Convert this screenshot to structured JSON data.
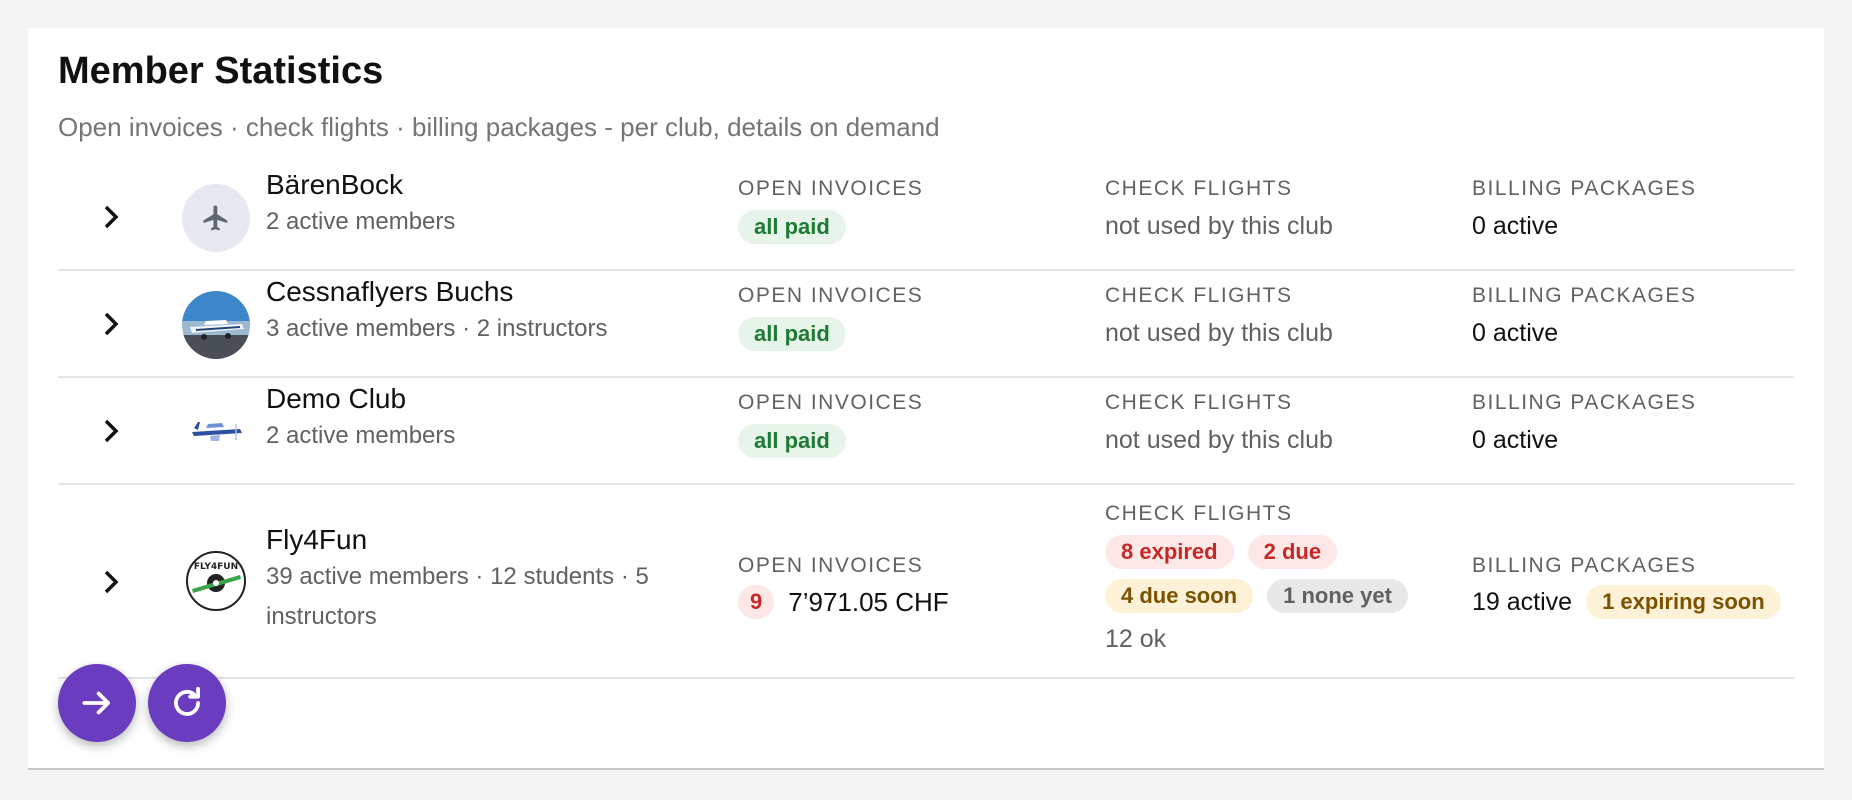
{
  "header": {
    "title": "Member Statistics",
    "subtitle": "Open invoices · check flights · billing packages - per club, details on demand"
  },
  "labels": {
    "open_invoices": "OPEN INVOICES",
    "check_flights": "CHECK FLIGHTS",
    "billing_packages": "BILLING PACKAGES"
  },
  "clubs": [
    {
      "name": "BärenBock",
      "meta": "2 active members",
      "avatar_icon": "airplane-icon",
      "open_invoices": {
        "status": "all paid"
      },
      "check_flights": {
        "text": "not used by this club"
      },
      "billing_packages": {
        "active": "0 active"
      }
    },
    {
      "name": "Cessnaflyers Buchs",
      "meta": "3 active members · 2 instructors",
      "avatar_icon": "aircraft-photo",
      "open_invoices": {
        "status": "all paid"
      },
      "check_flights": {
        "text": "not used by this club"
      },
      "billing_packages": {
        "active": "0 active"
      }
    },
    {
      "name": "Demo Club",
      "meta": "2 active members",
      "avatar_icon": "aircraft-logo",
      "open_invoices": {
        "status": "all paid"
      },
      "check_flights": {
        "text": "not used by this club"
      },
      "billing_packages": {
        "active": "0 active"
      }
    },
    {
      "name": "Fly4Fun",
      "meta": "39 active members · 12 students · 5 instructors",
      "avatar_icon": "fly4fun-logo",
      "avatar_text": "FLY4FUN",
      "open_invoices": {
        "count": "9",
        "amount": "7’971.05 CHF"
      },
      "check_flights": {
        "expired": "8 expired",
        "due": "2 due",
        "due_soon": "4 due soon",
        "none_yet": "1 none yet",
        "ok": "12 ok"
      },
      "billing_packages": {
        "active": "19 active",
        "expiring": "1 expiring soon"
      }
    }
  ],
  "actions": {
    "open_icon": "arrow-right-icon",
    "refresh_icon": "refresh-icon"
  },
  "colors": {
    "accent": "#6a3cc0",
    "paid_bg": "#e6f4ea",
    "paid_fg": "#1e7a34",
    "expired_bg": "#fde7e7",
    "expired_fg": "#c62828",
    "warn_bg": "#fdf1d8",
    "warn_fg": "#7a5200"
  }
}
